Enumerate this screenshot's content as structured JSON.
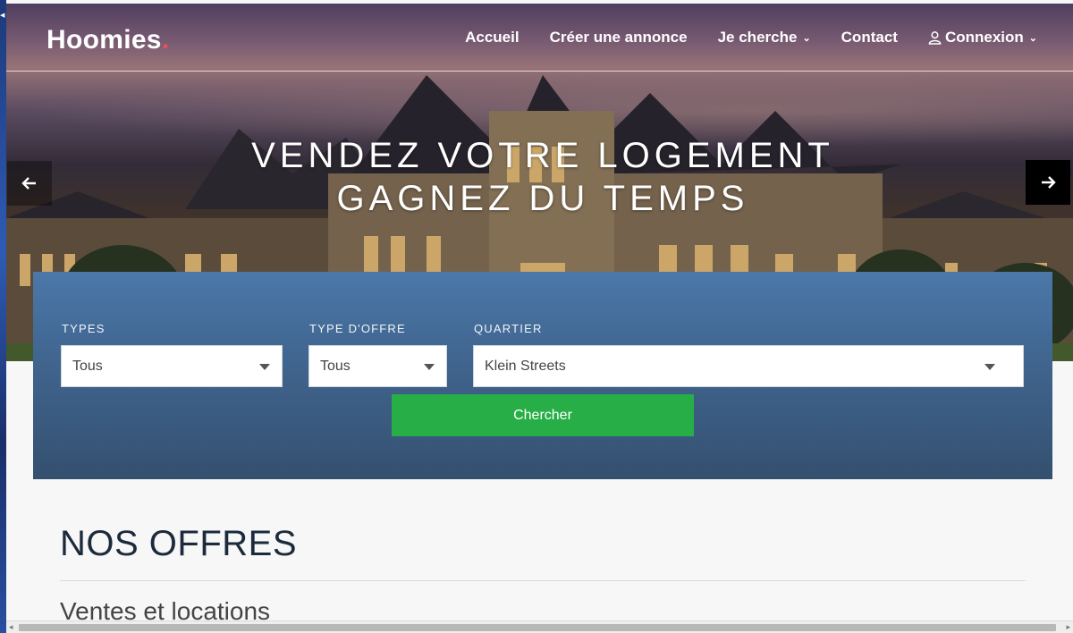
{
  "brand": {
    "name": "Hoomies",
    "dot": "."
  },
  "nav": {
    "items": [
      {
        "label": "Accueil"
      },
      {
        "label": "Créer une annonce"
      },
      {
        "label": "Je cherche",
        "dropdown": true
      },
      {
        "label": "Contact"
      },
      {
        "label": "Connexion",
        "dropdown": true,
        "icon": "user-icon"
      }
    ]
  },
  "hero": {
    "line1": "VENDEZ VOTRE LOGEMENT",
    "line2": "GAGNEZ DU TEMPS",
    "prev_icon": "arrow-left-icon",
    "next_icon": "arrow-right-icon"
  },
  "search": {
    "types": {
      "label": "TYPES",
      "value": "Tous"
    },
    "offer_type": {
      "label": "TYPE D'OFFRE",
      "value": "Tous"
    },
    "district": {
      "label": "QUARTIER",
      "value": "Klein Streets"
    },
    "button": "Chercher"
  },
  "offers": {
    "title": "NOS OFFRES",
    "subtitle": "Ventes et locations"
  },
  "colors": {
    "brand_dot": "#e8505b",
    "search_button": "#27ae47",
    "panel_top": "#4a78a8",
    "panel_bottom": "#34506f"
  }
}
